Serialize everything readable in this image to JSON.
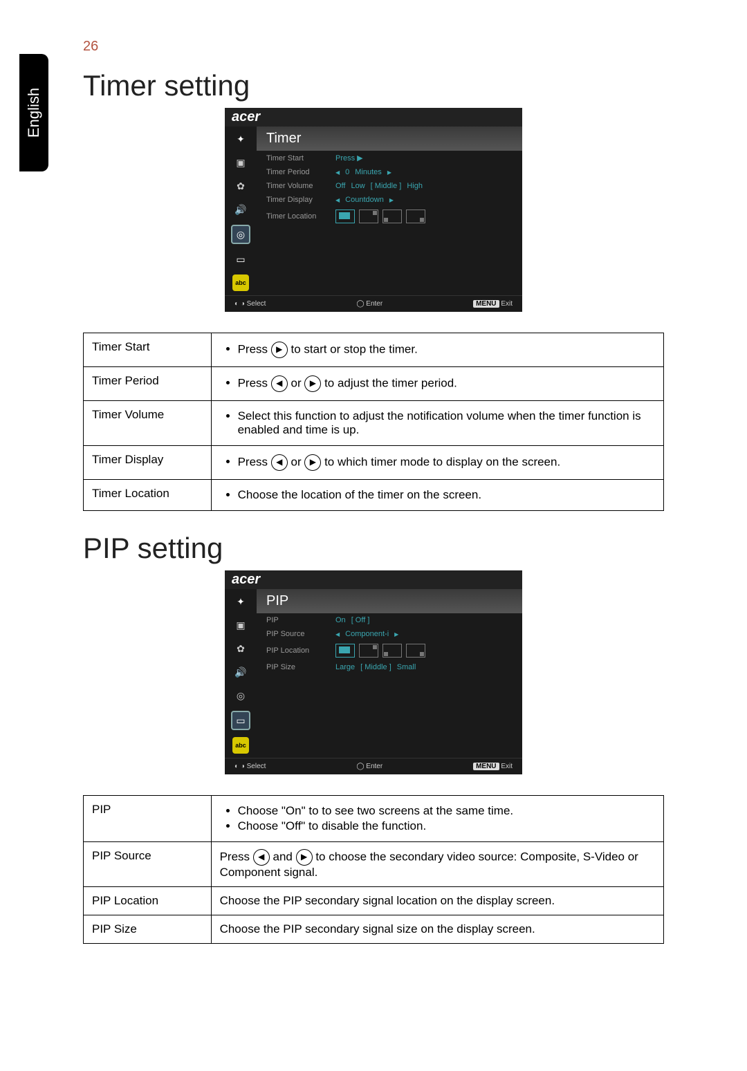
{
  "page_number": "26",
  "side_tab": "English",
  "section1": {
    "heading": "Timer setting",
    "osd": {
      "brand": "acer",
      "title": "Timer",
      "footer_select": "Select",
      "footer_enter": "Enter",
      "footer_menu": "MENU",
      "footer_exit": "Exit",
      "icons": [
        "color-icon",
        "image-icon",
        "gear-icon",
        "speaker-icon",
        "timer-icon",
        "pip-icon",
        "abc-icon"
      ],
      "rows": {
        "timer_start_label": "Timer Start",
        "timer_start_value": "Press  ▶",
        "timer_period_label": "Timer Period",
        "timer_period_value_left": "◀",
        "timer_period_value_num": "0",
        "timer_period_value_unit": "Minutes",
        "timer_period_value_right": "▶",
        "timer_volume_label": "Timer Volume",
        "timer_volume_off": "Off",
        "timer_volume_low": "Low",
        "timer_volume_mid": "[ Middle ]",
        "timer_volume_high": "High",
        "timer_display_label": "Timer Display",
        "timer_display_left": "◀",
        "timer_display_value": "Countdown",
        "timer_display_right": "▶",
        "timer_location_label": "Timer Location"
      }
    },
    "table": {
      "timer_start_label": "Timer Start",
      "timer_start_text_before": "Press ",
      "timer_start_text_after": " to start or stop the timer.",
      "timer_period_label": "Timer Period",
      "timer_period_before": "Press ",
      "timer_period_mid": " or ",
      "timer_period_after": " to adjust the timer period.",
      "timer_volume_label": "Timer Volume",
      "timer_volume_text": "Select this function to adjust the notification volume when the timer function is enabled and time is up.",
      "timer_display_label": "Timer Display",
      "timer_display_before": "Press ",
      "timer_display_mid": " or ",
      "timer_display_after": " to which timer mode to display on the screen.",
      "timer_location_label": "Timer Location",
      "timer_location_text": "Choose the location of the timer on the screen."
    }
  },
  "section2": {
    "heading": "PIP setting",
    "osd": {
      "brand": "acer",
      "title": "PIP",
      "footer_select": "Select",
      "footer_enter": "Enter",
      "footer_menu": "MENU",
      "footer_exit": "Exit",
      "rows": {
        "pip_label": "PIP",
        "pip_on": "On",
        "pip_off": "[ Off ]",
        "pip_source_label": "PIP Source",
        "pip_source_left": "◀",
        "pip_source_value": "Component-i",
        "pip_source_right": "▶",
        "pip_location_label": "PIP Location",
        "pip_size_label": "PIP Size",
        "pip_size_large": "Large",
        "pip_size_mid": "[ Middle ]",
        "pip_size_small": "Small"
      }
    },
    "table": {
      "pip_label": "PIP",
      "pip_on_text": "Choose \"On\" to to see two screens at the same time.",
      "pip_off_text": "Choose \"Off\" to disable the function.",
      "pip_source_label": "PIP Source",
      "pip_source_before": "Press ",
      "pip_source_mid": " and ",
      "pip_source_after": " to choose the secondary video source: Composite, S-Video or Component signal.",
      "pip_location_label": "PIP Location",
      "pip_location_text": "Choose the PIP secondary signal location on the display screen.",
      "pip_size_label": "PIP Size",
      "pip_size_text": "Choose the PIP secondary signal size on the display screen."
    }
  },
  "glyphs": {
    "left": "◀",
    "right": "▶"
  }
}
